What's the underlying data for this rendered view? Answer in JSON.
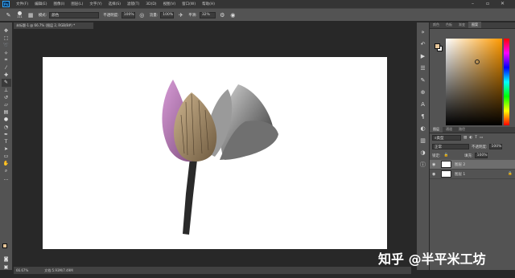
{
  "app": {
    "logo": "Ps"
  },
  "menubar": {
    "items": [
      "文件(F)",
      "编辑(E)",
      "图像(I)",
      "图层(L)",
      "文字(Y)",
      "选择(S)",
      "滤镜(T)",
      "3D(D)",
      "视图(V)",
      "窗口(W)",
      "帮助(H)"
    ]
  },
  "options": {
    "brush_size": "111",
    "mode_label": "模式:",
    "mode_value": "颜色",
    "opacity_label": "不透明度:",
    "opacity_value": "100%",
    "flow_label": "流量:",
    "flow_value": "100%",
    "smooth_label": "平滑:",
    "smooth_value": "32%"
  },
  "document": {
    "tab": "未标题-1 @ 66.7% (图层 2, RGB/8#) *",
    "zoom": "66.67%",
    "doc_info": "文档:5.93M/7.49M"
  },
  "panels": {
    "color_tabs": [
      "颜色",
      "色板",
      "渐变",
      "图案"
    ],
    "layer_tabs": [
      "图层",
      "通道",
      "路径"
    ],
    "filter_kind": "类型",
    "blend_mode": "正常",
    "opacity_label": "不透明度:",
    "opacity_value": "100%",
    "lock_label": "锁定:",
    "fill_label": "填充:",
    "fill_value": "100%",
    "layers": [
      {
        "name": "图层 2"
      },
      {
        "name": "图层 1"
      }
    ]
  },
  "watermark": "知乎 @半平米工坊",
  "colors": {
    "foreground": "#e8c79a",
    "background": "#ffffff",
    "accent": "#31a8ff"
  }
}
